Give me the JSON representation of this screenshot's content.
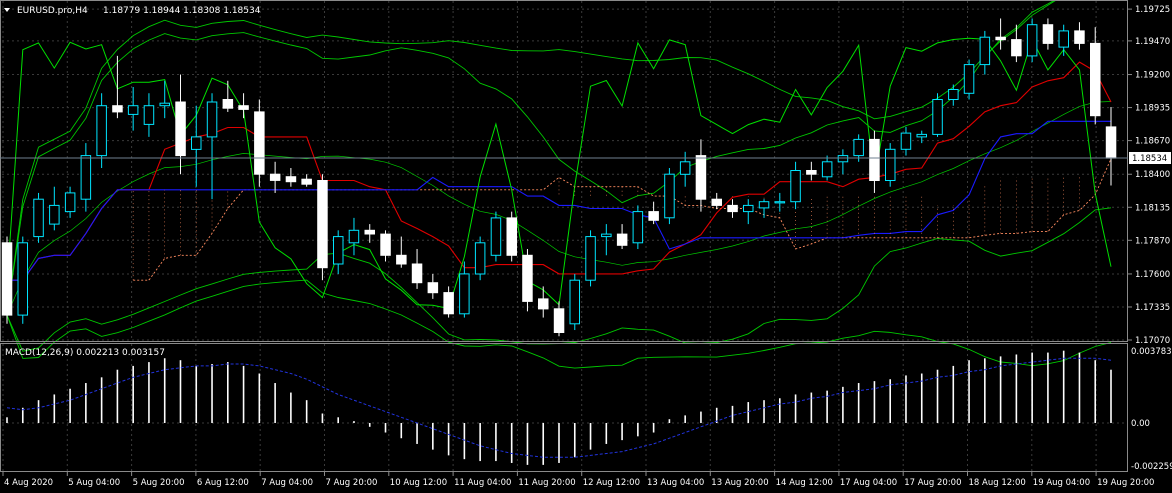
{
  "header": {
    "symbol_tf": "EURUSD.pro,H4",
    "ohlc": "1.18779 1.18944 1.18308 1.18534"
  },
  "macd_header": "MACD(12,26,9) 0.002213 0.003157",
  "price_axis": {
    "labels": [
      "1.19725",
      "1.19470",
      "1.19200",
      "1.18935",
      "1.18670",
      "1.18400",
      "1.18135",
      "1.17870",
      "1.17600",
      "1.17335",
      "1.17070"
    ],
    "current_price": "1.18534"
  },
  "macd_axis": {
    "labels": [
      "0.003783",
      "0.00",
      "-0.002259"
    ]
  },
  "time_axis": {
    "labels": [
      "4 Aug 2020",
      "5 Aug 04:00",
      "5 Aug 20:00",
      "6 Aug 12:00",
      "7 Aug 04:00",
      "7 Aug 20:00",
      "10 Aug 12:00",
      "11 Aug 04:00",
      "11 Aug 20:00",
      "12 Aug 12:00",
      "13 Aug 04:00",
      "13 Aug 20:00",
      "14 Aug 12:00",
      "17 Aug 04:00",
      "17 Aug 20:00",
      "18 Aug 12:00",
      "19 Aug 04:00",
      "19 Aug 20:00"
    ]
  },
  "colors": {
    "background": "#000000",
    "bull_candle": "#000000",
    "bull_border": "#00e5ff",
    "bear_candle": "#ffffff",
    "grid": "#3a3a3a",
    "bollinger": "#00c800",
    "ma_red": "#e00000",
    "ma_blue": "#1a1aff",
    "rsi_green": "#00e000",
    "ichimoku": "#ff8c60",
    "macd_hist": "#ffffff",
    "macd_signal": "#2233dd"
  },
  "chart_data": {
    "type": "candlestick",
    "symbol": "EURUSD.pro",
    "timeframe": "H4",
    "ylim": [
      1.1707,
      1.1975
    ],
    "candles": [
      {
        "o": 1.1785,
        "h": 1.179,
        "l": 1.172,
        "c": 1.1727
      },
      {
        "o": 1.1727,
        "h": 1.179,
        "l": 1.172,
        "c": 1.1785
      },
      {
        "o": 1.179,
        "h": 1.1825,
        "l": 1.1785,
        "c": 1.182
      },
      {
        "o": 1.18,
        "h": 1.183,
        "l": 1.1795,
        "c": 1.1815
      },
      {
        "o": 1.181,
        "h": 1.183,
        "l": 1.1805,
        "c": 1.1825
      },
      {
        "o": 1.182,
        "h": 1.1865,
        "l": 1.181,
        "c": 1.1855
      },
      {
        "o": 1.1855,
        "h": 1.1905,
        "l": 1.1845,
        "c": 1.1895
      },
      {
        "o": 1.1895,
        "h": 1.1935,
        "l": 1.1885,
        "c": 1.189
      },
      {
        "o": 1.1888,
        "h": 1.191,
        "l": 1.1875,
        "c": 1.1895
      },
      {
        "o": 1.188,
        "h": 1.1905,
        "l": 1.187,
        "c": 1.1895
      },
      {
        "o": 1.1895,
        "h": 1.1915,
        "l": 1.1885,
        "c": 1.1897
      },
      {
        "o": 1.1898,
        "h": 1.192,
        "l": 1.184,
        "c": 1.1855
      },
      {
        "o": 1.186,
        "h": 1.1895,
        "l": 1.183,
        "c": 1.187
      },
      {
        "o": 1.187,
        "h": 1.1905,
        "l": 1.182,
        "c": 1.1898
      },
      {
        "o": 1.19,
        "h": 1.1915,
        "l": 1.189,
        "c": 1.1893
      },
      {
        "o": 1.1895,
        "h": 1.1905,
        "l": 1.1885,
        "c": 1.1892
      },
      {
        "o": 1.189,
        "h": 1.19,
        "l": 1.183,
        "c": 1.184
      },
      {
        "o": 1.184,
        "h": 1.185,
        "l": 1.1825,
        "c": 1.1835
      },
      {
        "o": 1.1838,
        "h": 1.1845,
        "l": 1.183,
        "c": 1.1834
      },
      {
        "o": 1.1836,
        "h": 1.184,
        "l": 1.183,
        "c": 1.1832
      },
      {
        "o": 1.1835,
        "h": 1.184,
        "l": 1.1755,
        "c": 1.1765
      },
      {
        "o": 1.1768,
        "h": 1.1795,
        "l": 1.176,
        "c": 1.179
      },
      {
        "o": 1.1785,
        "h": 1.1805,
        "l": 1.1775,
        "c": 1.1795
      },
      {
        "o": 1.1795,
        "h": 1.18,
        "l": 1.1785,
        "c": 1.1792
      },
      {
        "o": 1.1792,
        "h": 1.1795,
        "l": 1.177,
        "c": 1.1775
      },
      {
        "o": 1.1775,
        "h": 1.179,
        "l": 1.1765,
        "c": 1.1768
      },
      {
        "o": 1.1768,
        "h": 1.178,
        "l": 1.1748,
        "c": 1.1753
      },
      {
        "o": 1.1753,
        "h": 1.176,
        "l": 1.174,
        "c": 1.1745
      },
      {
        "o": 1.1745,
        "h": 1.175,
        "l": 1.1725,
        "c": 1.1728
      },
      {
        "o": 1.1728,
        "h": 1.177,
        "l": 1.1725,
        "c": 1.176
      },
      {
        "o": 1.176,
        "h": 1.179,
        "l": 1.1755,
        "c": 1.1785
      },
      {
        "o": 1.1775,
        "h": 1.181,
        "l": 1.177,
        "c": 1.1805
      },
      {
        "o": 1.1805,
        "h": 1.181,
        "l": 1.177,
        "c": 1.1775
      },
      {
        "o": 1.1775,
        "h": 1.178,
        "l": 1.173,
        "c": 1.1738
      },
      {
        "o": 1.174,
        "h": 1.175,
        "l": 1.1725,
        "c": 1.1732
      },
      {
        "o": 1.1732,
        "h": 1.1738,
        "l": 1.171,
        "c": 1.1713
      },
      {
        "o": 1.172,
        "h": 1.176,
        "l": 1.1715,
        "c": 1.1755
      },
      {
        "o": 1.1755,
        "h": 1.1795,
        "l": 1.175,
        "c": 1.179
      },
      {
        "o": 1.179,
        "h": 1.18,
        "l": 1.1775,
        "c": 1.1792
      },
      {
        "o": 1.1792,
        "h": 1.18,
        "l": 1.178,
        "c": 1.1783
      },
      {
        "o": 1.1785,
        "h": 1.1815,
        "l": 1.178,
        "c": 1.181
      },
      {
        "o": 1.181,
        "h": 1.1818,
        "l": 1.18,
        "c": 1.1803
      },
      {
        "o": 1.1805,
        "h": 1.1845,
        "l": 1.18,
        "c": 1.184
      },
      {
        "o": 1.184,
        "h": 1.1858,
        "l": 1.183,
        "c": 1.185
      },
      {
        "o": 1.1855,
        "h": 1.1868,
        "l": 1.181,
        "c": 1.182
      },
      {
        "o": 1.182,
        "h": 1.1825,
        "l": 1.1812,
        "c": 1.1815
      },
      {
        "o": 1.1815,
        "h": 1.182,
        "l": 1.1805,
        "c": 1.181
      },
      {
        "o": 1.181,
        "h": 1.182,
        "l": 1.18,
        "c": 1.1815
      },
      {
        "o": 1.1813,
        "h": 1.182,
        "l": 1.1805,
        "c": 1.1818
      },
      {
        "o": 1.1817,
        "h": 1.1825,
        "l": 1.181,
        "c": 1.1818
      },
      {
        "o": 1.1818,
        "h": 1.185,
        "l": 1.1812,
        "c": 1.1843
      },
      {
        "o": 1.1843,
        "h": 1.185,
        "l": 1.1835,
        "c": 1.184
      },
      {
        "o": 1.1838,
        "h": 1.1855,
        "l": 1.1835,
        "c": 1.185
      },
      {
        "o": 1.185,
        "h": 1.186,
        "l": 1.184,
        "c": 1.1855
      },
      {
        "o": 1.1855,
        "h": 1.1872,
        "l": 1.185,
        "c": 1.1868
      },
      {
        "o": 1.1868,
        "h": 1.1875,
        "l": 1.1825,
        "c": 1.1835
      },
      {
        "o": 1.1835,
        "h": 1.1865,
        "l": 1.183,
        "c": 1.186
      },
      {
        "o": 1.186,
        "h": 1.1878,
        "l": 1.1855,
        "c": 1.1873
      },
      {
        "o": 1.187,
        "h": 1.1875,
        "l": 1.1865,
        "c": 1.1872
      },
      {
        "o": 1.1872,
        "h": 1.1905,
        "l": 1.187,
        "c": 1.19
      },
      {
        "o": 1.19,
        "h": 1.1912,
        "l": 1.1895,
        "c": 1.1908
      },
      {
        "o": 1.1905,
        "h": 1.1932,
        "l": 1.19,
        "c": 1.1928
      },
      {
        "o": 1.1928,
        "h": 1.1955,
        "l": 1.192,
        "c": 1.195
      },
      {
        "o": 1.195,
        "h": 1.1965,
        "l": 1.194,
        "c": 1.1948
      },
      {
        "o": 1.1948,
        "h": 1.196,
        "l": 1.193,
        "c": 1.1935
      },
      {
        "o": 1.1935,
        "h": 1.1965,
        "l": 1.193,
        "c": 1.196
      },
      {
        "o": 1.196,
        "h": 1.1965,
        "l": 1.194,
        "c": 1.1945
      },
      {
        "o": 1.1942,
        "h": 1.196,
        "l": 1.1935,
        "c": 1.1955
      },
      {
        "o": 1.1955,
        "h": 1.1962,
        "l": 1.194,
        "c": 1.1945
      },
      {
        "o": 1.1945,
        "h": 1.1958,
        "l": 1.188,
        "c": 1.1887
      },
      {
        "o": 1.1878,
        "h": 1.1894,
        "l": 1.1831,
        "c": 1.1853
      }
    ],
    "macd_hist": [
      0.0003,
      0.0008,
      0.0012,
      0.0015,
      0.0018,
      0.0021,
      0.0024,
      0.0028,
      0.003,
      0.0032,
      0.0034,
      0.0033,
      0.003,
      0.0031,
      0.0032,
      0.003,
      0.0026,
      0.0021,
      0.0016,
      0.0012,
      0.0005,
      0.0003,
      0.0001,
      -0.0002,
      -0.0005,
      -0.0008,
      -0.0011,
      -0.0014,
      -0.0017,
      -0.0019,
      -0.002,
      -0.002,
      -0.0021,
      -0.0022,
      -0.0022,
      -0.0021,
      -0.0018,
      -0.0014,
      -0.0011,
      -0.0009,
      -0.0007,
      -0.0005,
      0.0002,
      0.0004,
      0.0006,
      0.0008,
      0.0009,
      0.0011,
      0.0012,
      0.0013,
      0.0015,
      0.0016,
      0.0017,
      0.0019,
      0.0021,
      0.0022,
      0.0023,
      0.0025,
      0.0026,
      0.0028,
      0.003,
      0.0033,
      0.0034,
      0.0035,
      0.0036,
      0.0037,
      0.0037,
      0.0038,
      0.0037,
      0.0033,
      0.0028
    ],
    "macd_signal": [
      0.0008,
      0.0007,
      0.0008,
      0.001,
      0.0012,
      0.0015,
      0.0018,
      0.0021,
      0.0024,
      0.0026,
      0.0028,
      0.0029,
      0.003,
      0.003,
      0.0031,
      0.0031,
      0.003,
      0.0028,
      0.0026,
      0.0023,
      0.0019,
      0.0015,
      0.0012,
      0.0009,
      0.0006,
      0.0003,
      0.0,
      -0.0003,
      -0.0006,
      -0.0009,
      -0.0012,
      -0.0014,
      -0.0016,
      -0.0017,
      -0.0018,
      -0.0018,
      -0.0018,
      -0.0017,
      -0.0016,
      -0.0015,
      -0.0013,
      -0.0011,
      -0.0008,
      -0.0005,
      -0.0002,
      0.0001,
      0.0004,
      0.0006,
      0.0008,
      0.001,
      0.0011,
      0.0013,
      0.0014,
      0.0016,
      0.0017,
      0.0018,
      0.002,
      0.0021,
      0.0022,
      0.0024,
      0.0025,
      0.0027,
      0.0028,
      0.003,
      0.0031,
      0.0032,
      0.0033,
      0.0034,
      0.0034,
      0.0034,
      0.0033
    ],
    "macd_ylim": [
      -0.002259,
      0.003783
    ]
  }
}
